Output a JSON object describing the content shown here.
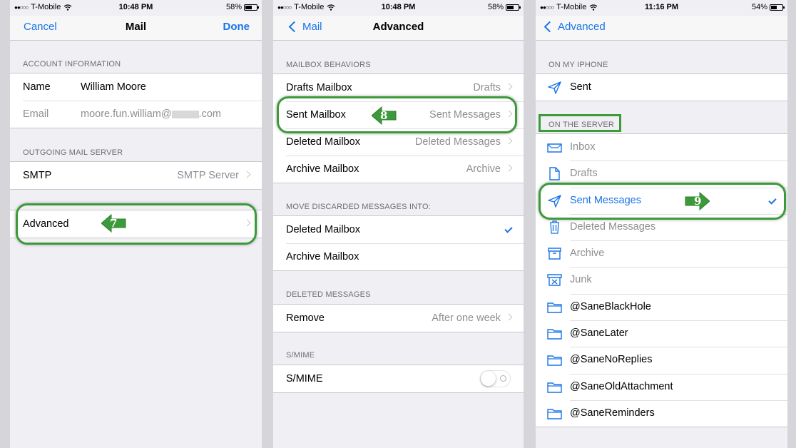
{
  "status": {
    "carrier": "T-Mobile",
    "p1": {
      "time": "10:48 PM",
      "battery": "58%",
      "battery_level": 0.58
    },
    "p2": {
      "time": "10:48 PM",
      "battery": "58%",
      "battery_level": 0.58
    },
    "p3": {
      "time": "11:16 PM",
      "battery": "54%",
      "battery_level": 0.54
    }
  },
  "screen1": {
    "nav": {
      "left": "Cancel",
      "title": "Mail",
      "right": "Done"
    },
    "account_header": "ACCOUNT INFORMATION",
    "name_label": "Name",
    "name_value": "William Moore",
    "email_label": "Email",
    "email_prefix": "moore.fun.william@",
    "email_suffix": ".com",
    "outgoing_header": "OUTGOING MAIL SERVER",
    "smtp_label": "SMTP",
    "smtp_value": "SMTP Server",
    "advanced_label": "Advanced",
    "step": "7"
  },
  "screen2": {
    "nav": {
      "back": "Mail",
      "title": "Advanced"
    },
    "behaviors_header": "MAILBOX BEHAVIORS",
    "rows": [
      {
        "label": "Drafts Mailbox",
        "value": "Drafts"
      },
      {
        "label": "Sent Mailbox",
        "value": "Sent Messages"
      },
      {
        "label": "Deleted Mailbox",
        "value": "Deleted Messages"
      },
      {
        "label": "Archive Mailbox",
        "value": "Archive"
      }
    ],
    "discard_header": "MOVE DISCARDED MESSAGES INTO:",
    "discard_options": [
      "Deleted Mailbox",
      "Archive Mailbox"
    ],
    "deleted_header": "DELETED MESSAGES",
    "remove_label": "Remove",
    "remove_value": "After one week",
    "smime_header": "S/MIME",
    "smime_label": "S/MIME",
    "step": "8"
  },
  "screen3": {
    "nav": {
      "back": "Advanced"
    },
    "on_iphone_header": "ON MY IPHONE",
    "local_sent": "Sent",
    "server_header": "ON THE SERVER",
    "mailboxes": [
      {
        "name": "Inbox",
        "icon": "inbox-icon"
      },
      {
        "name": "Drafts",
        "icon": "document-icon"
      },
      {
        "name": "Sent Messages",
        "icon": "paper-plane-icon"
      },
      {
        "name": "Deleted Messages",
        "icon": "trash-icon"
      },
      {
        "name": "Archive",
        "icon": "archive-box-icon"
      },
      {
        "name": "Junk",
        "icon": "junk-bin-icon"
      },
      {
        "name": "@SaneBlackHole",
        "icon": "folder-icon"
      },
      {
        "name": "@SaneLater",
        "icon": "folder-icon"
      },
      {
        "name": "@SaneNoReplies",
        "icon": "folder-icon"
      },
      {
        "name": "@SaneOldAttachment",
        "icon": "folder-icon"
      },
      {
        "name": "@SaneReminders",
        "icon": "folder-icon"
      }
    ],
    "step": "9"
  },
  "colors": {
    "accent": "#1a73e8",
    "highlight": "#3c9a3a",
    "background": "#efeff4"
  }
}
